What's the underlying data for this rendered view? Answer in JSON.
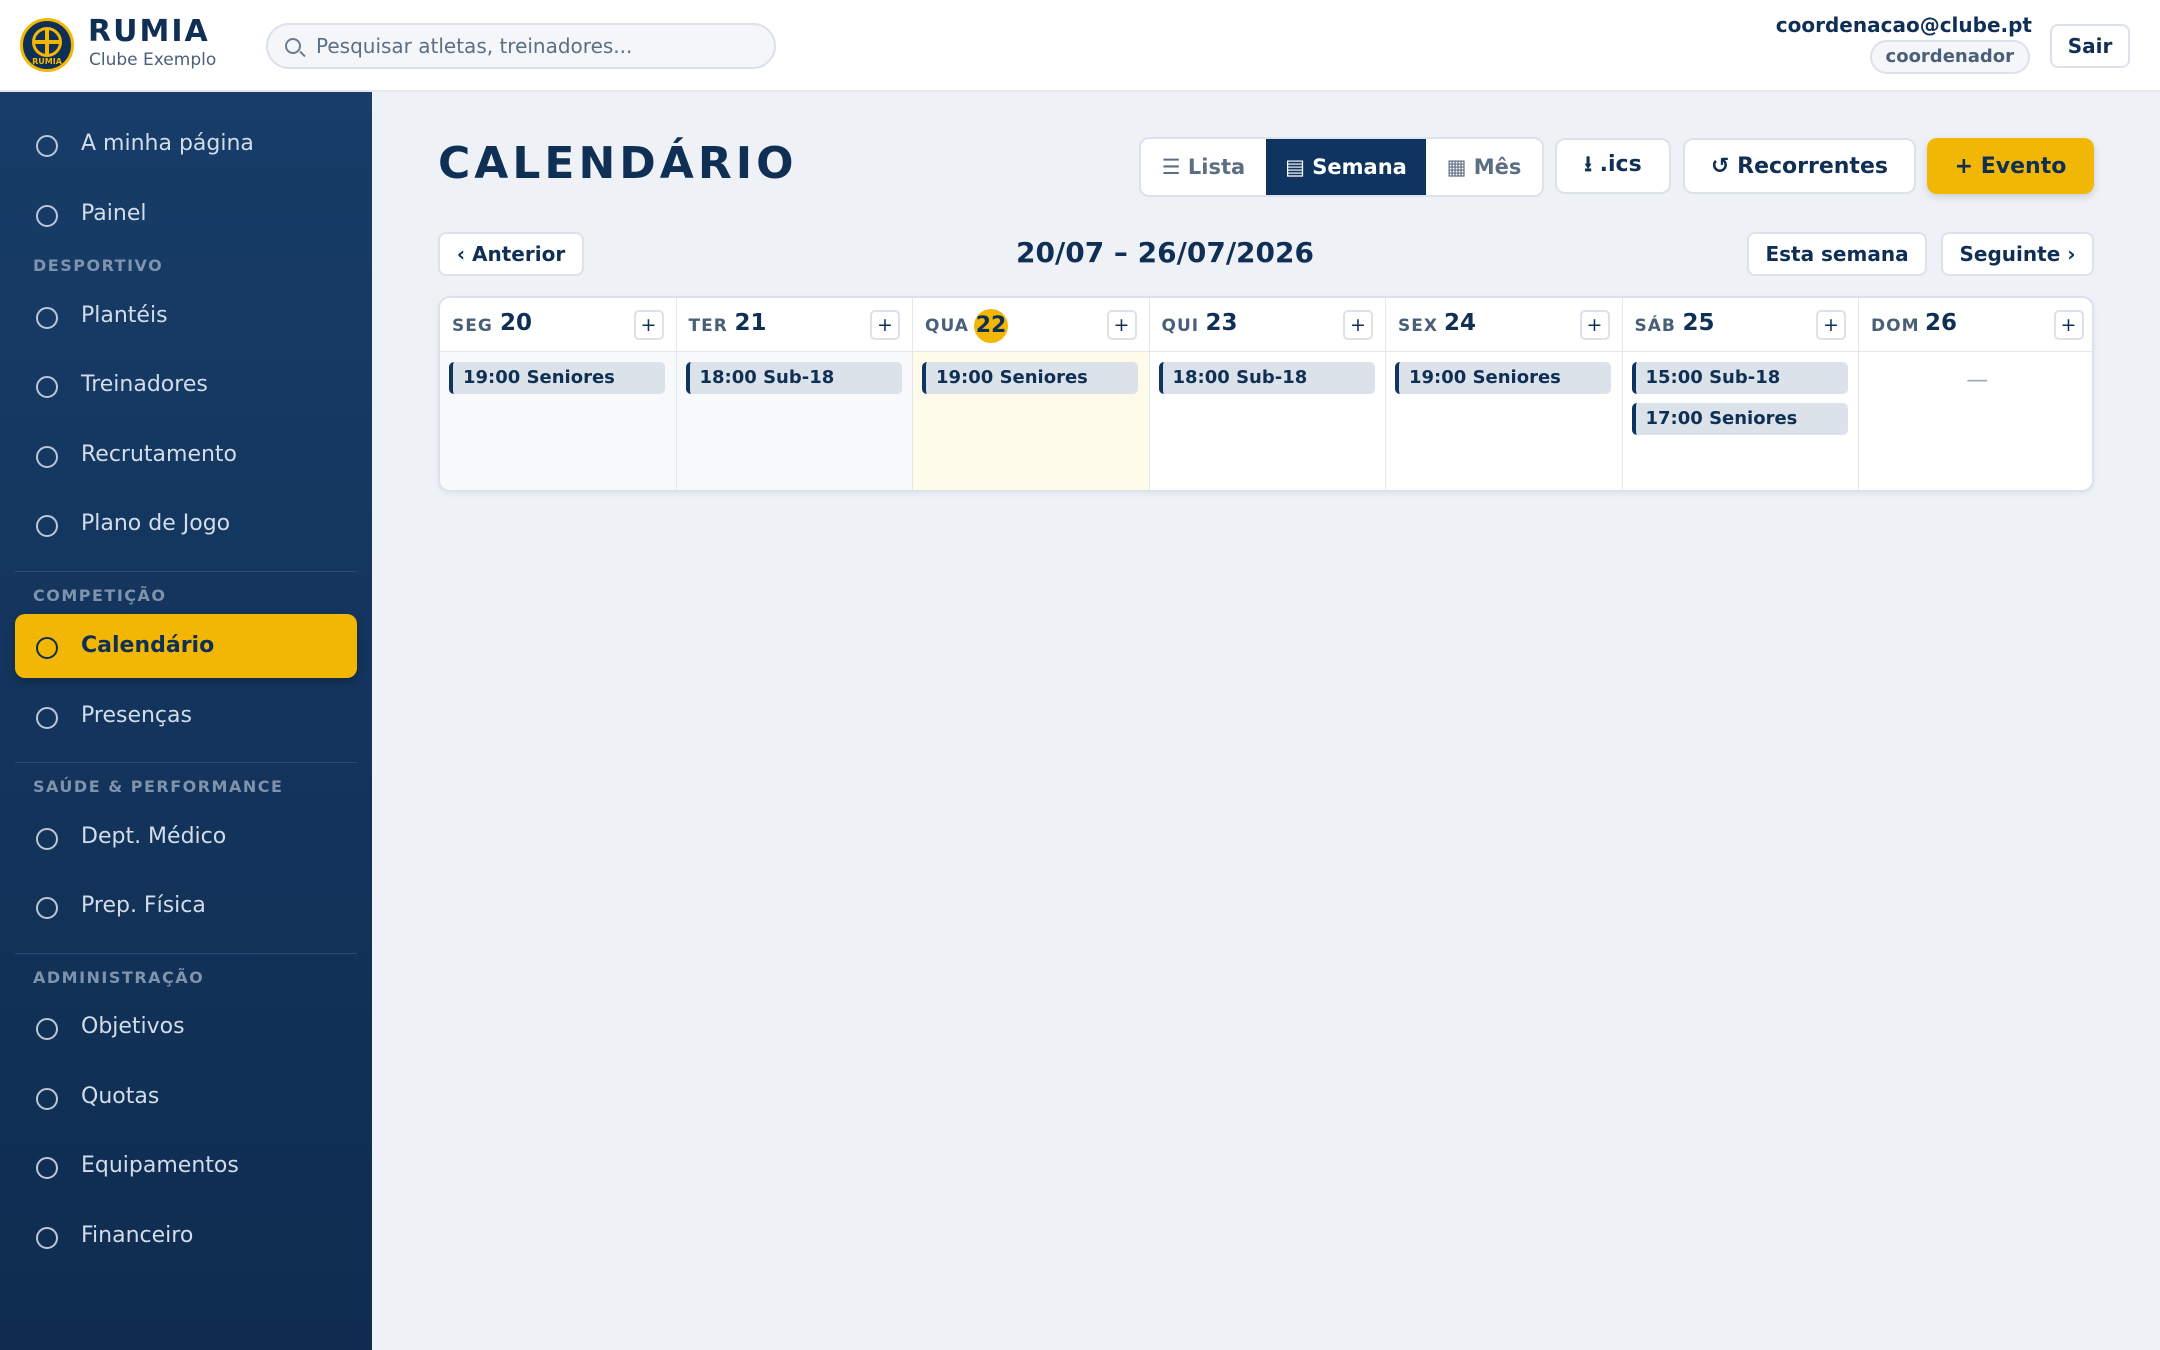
{
  "brand": {
    "name": "RUMIA",
    "subtitle": "Clube Exemplo",
    "logo_text": "RUMIA"
  },
  "search": {
    "placeholder": "Pesquisar atletas, treinadores..."
  },
  "user": {
    "email": "coordenacao@clube.pt",
    "role": "coordenador",
    "logout_label": "Sair"
  },
  "sidebar": {
    "top_items": [
      {
        "label": "A minha página",
        "icon": "circle-icon"
      },
      {
        "label": "Painel",
        "icon": "circle-icon"
      }
    ],
    "sections": [
      {
        "title": "DESPORTIVO",
        "items": [
          {
            "label": "Plantéis"
          },
          {
            "label": "Treinadores"
          },
          {
            "label": "Recrutamento"
          },
          {
            "label": "Plano de Jogo"
          }
        ]
      },
      {
        "title": "COMPETIÇÃO",
        "items": [
          {
            "label": "Calendário",
            "active": true
          },
          {
            "label": "Presenças"
          }
        ]
      },
      {
        "title": "SAÚDE & PERFORMANCE",
        "items": [
          {
            "label": "Dept. Médico"
          },
          {
            "label": "Prep. Física"
          }
        ]
      },
      {
        "title": "ADMINISTRAÇÃO",
        "items": [
          {
            "label": "Objetivos"
          },
          {
            "label": "Quotas"
          },
          {
            "label": "Equipamentos"
          },
          {
            "label": "Financeiro"
          }
        ]
      }
    ]
  },
  "page": {
    "title": "CALENDÁRIO"
  },
  "toolbar": {
    "views": [
      {
        "label": "☰ Lista",
        "active": false
      },
      {
        "label": "▤ Semana",
        "active": true
      },
      {
        "label": "▦ Mês",
        "active": false
      }
    ],
    "ics_label": "⭳ .ics",
    "recurring_label": "↺ Recorrentes",
    "new_event_label": "+ Evento"
  },
  "week_nav": {
    "prev_label": "‹ Anterior",
    "range": "20/07 – 26/07/2026",
    "this_week_label": "Esta semana",
    "next_label": "Seguinte ›"
  },
  "colors": {
    "accent": "#f2b705",
    "primary": "#0f3460",
    "sidebar": "#173d68"
  },
  "days": [
    {
      "dow": "SEG",
      "num": "20",
      "today": false,
      "past": true,
      "events": [
        "19:00 Seniores"
      ]
    },
    {
      "dow": "TER",
      "num": "21",
      "today": false,
      "past": true,
      "events": [
        "18:00 Sub-18"
      ]
    },
    {
      "dow": "QUA",
      "num": "22",
      "today": true,
      "past": false,
      "events": [
        "19:00 Seniores"
      ]
    },
    {
      "dow": "QUI",
      "num": "23",
      "today": false,
      "past": false,
      "events": [
        "18:00 Sub-18"
      ]
    },
    {
      "dow": "SEX",
      "num": "24",
      "today": false,
      "past": false,
      "events": [
        "19:00 Seniores"
      ]
    },
    {
      "dow": "SÁB",
      "num": "25",
      "today": false,
      "past": false,
      "events": [
        "15:00 Sub-18",
        "17:00 Seniores"
      ]
    },
    {
      "dow": "DOM",
      "num": "26",
      "today": false,
      "past": false,
      "events": [],
      "empty_label": "—"
    }
  ],
  "add_label": "+"
}
